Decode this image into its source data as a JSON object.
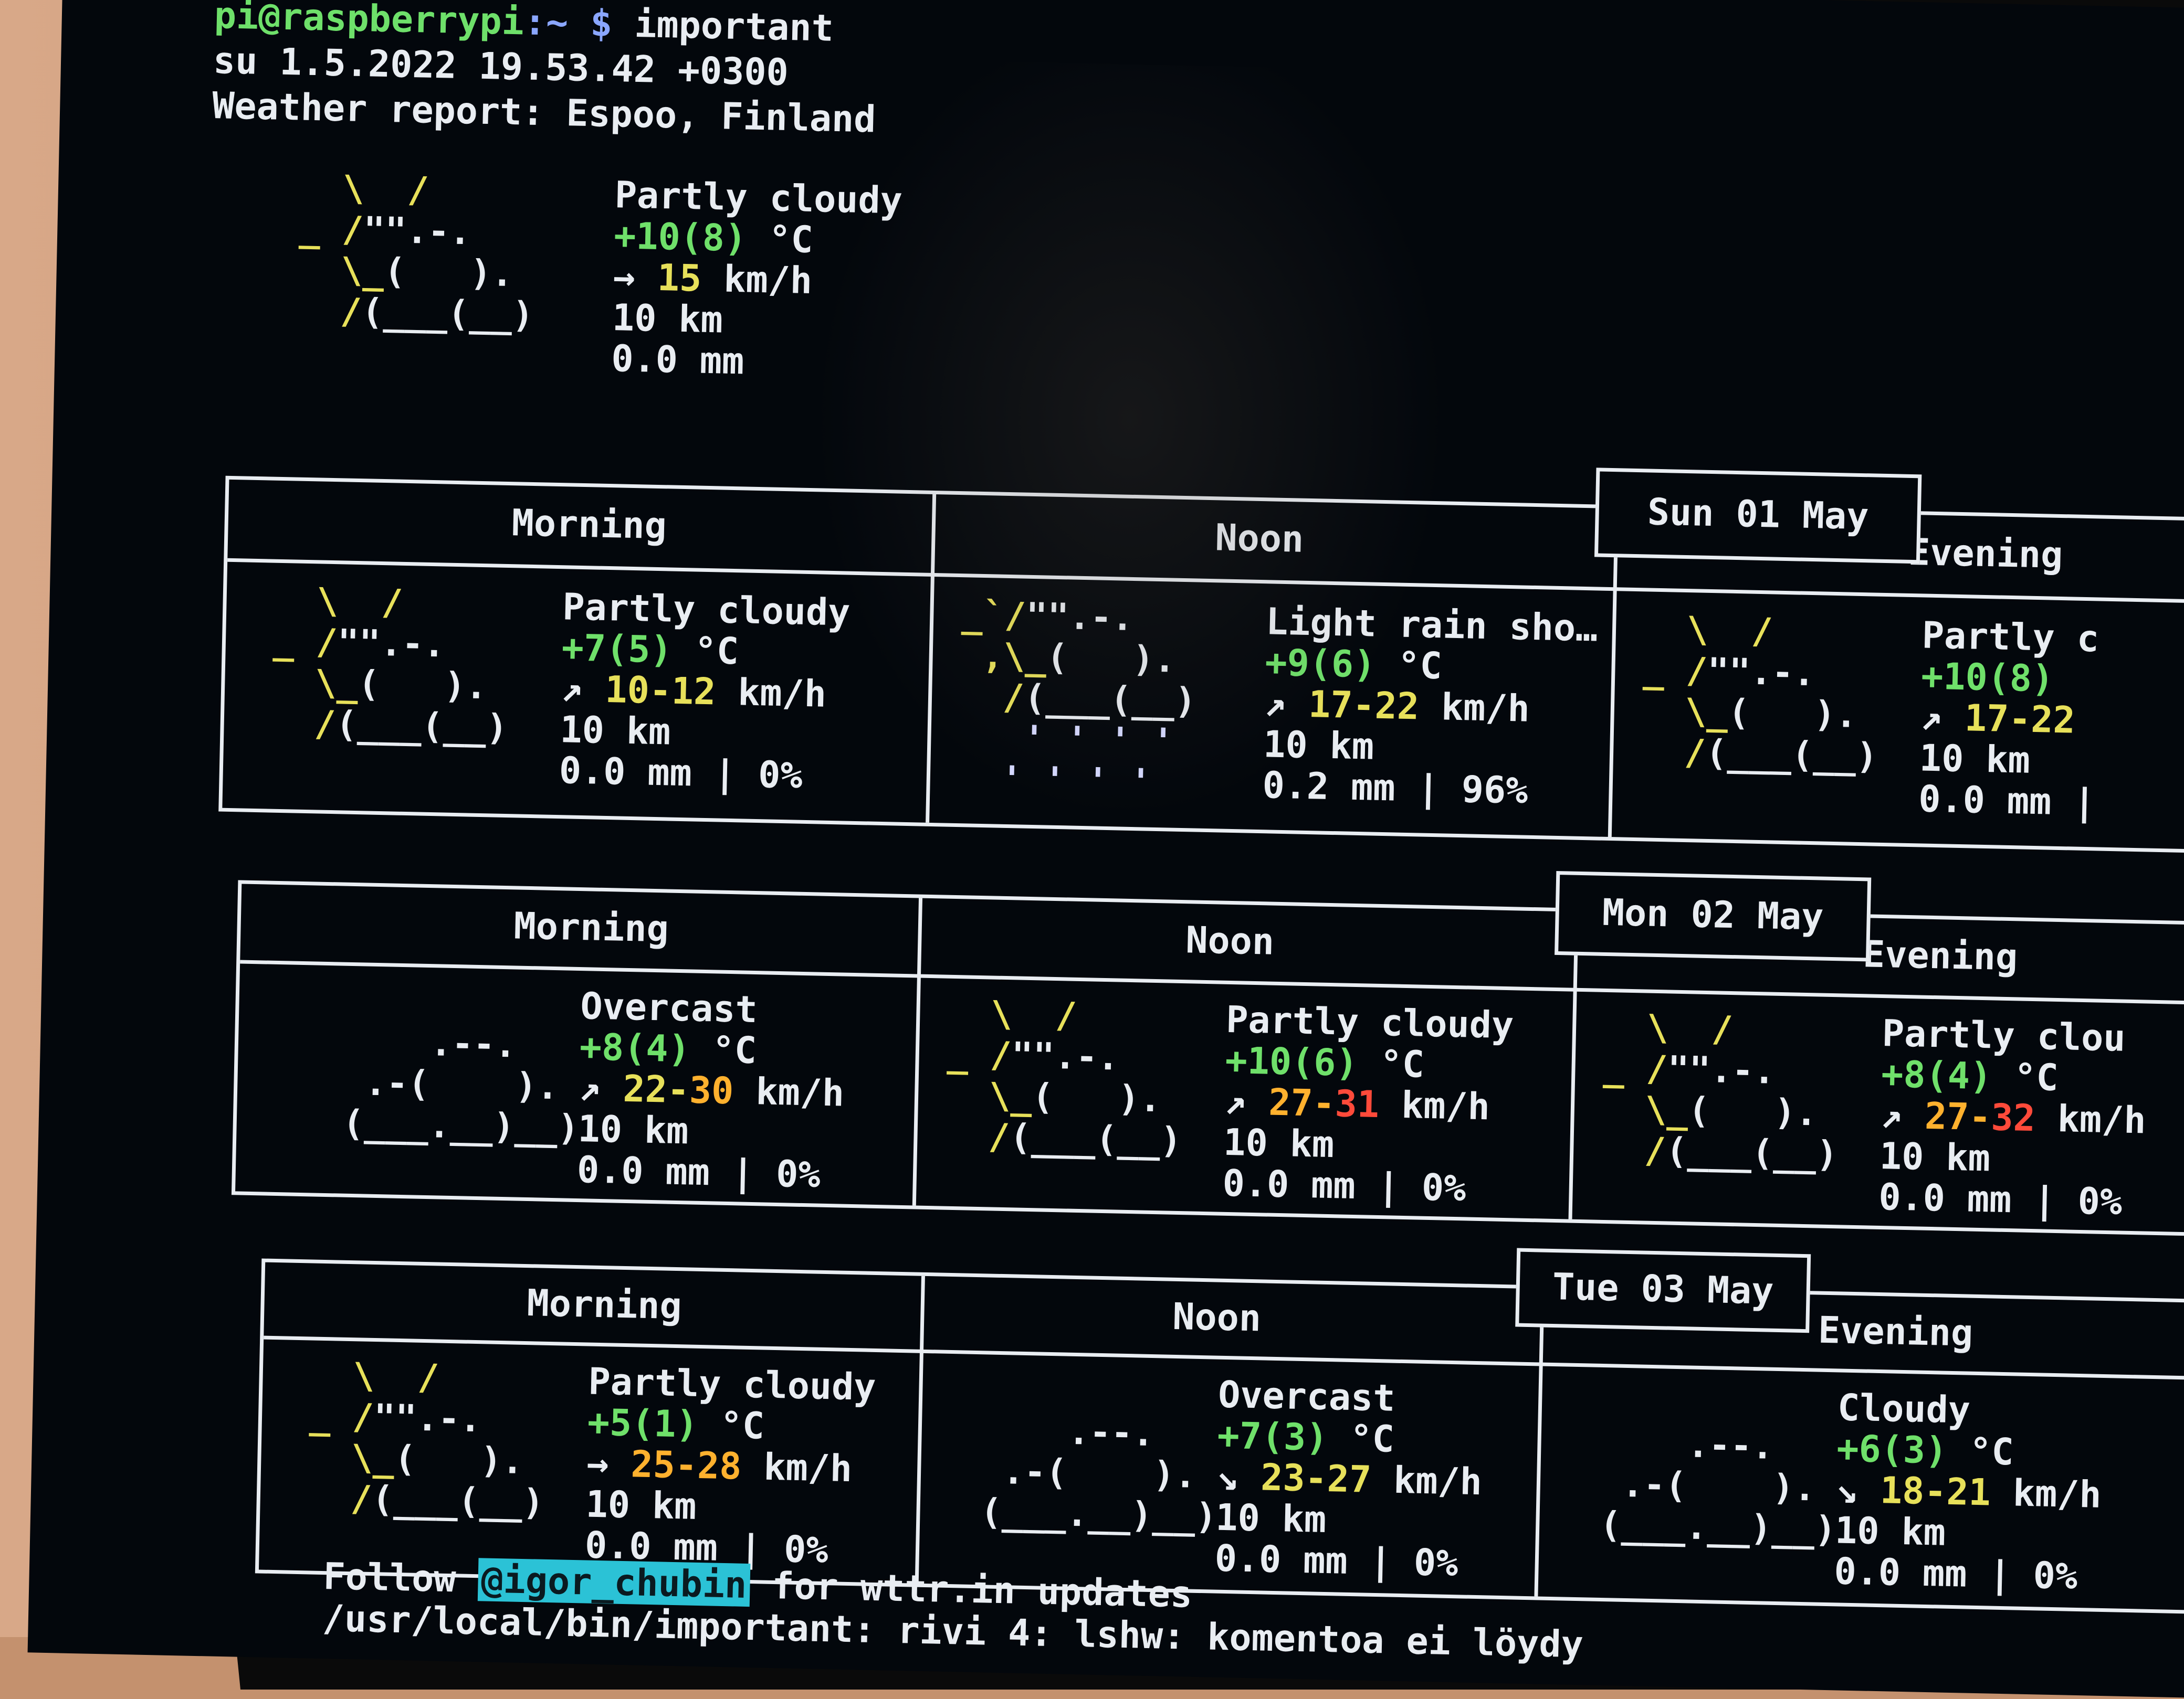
{
  "terminal": {
    "prompt_user": "pi@raspberrypi",
    "prompt_path": ":~ $",
    "command": " important",
    "date_line": "su 1.5.2022 19.53.42 +0300",
    "report_title": "Weather report: Espoo, Finland"
  },
  "current": {
    "condition": "Partly cloudy",
    "temp": "+10(8)",
    "temp_unit": " °C",
    "wind_arrow": "→",
    "wind": "15",
    "wind_unit": " km/h",
    "visibility": "10 km",
    "precip": "0.0 mm"
  },
  "days": [
    {
      "date": "Sun 01 May",
      "periods": [
        {
          "name": "Morning",
          "condition": "Partly cloudy",
          "temp": "+7(5)",
          "wind_arrow": "↗",
          "wind_lo": "10",
          "wind_hi": "12",
          "visibility": "10 km",
          "precip": "0.0 mm | 0%"
        },
        {
          "name": "Noon",
          "condition": "Light rain sho…",
          "temp": "+9(6)",
          "wind_arrow": "↗",
          "wind_lo": "17",
          "wind_hi": "22",
          "visibility": "10 km",
          "precip": "0.2 mm | 96%"
        },
        {
          "name": "Evening",
          "condition": "Partly c",
          "temp": "+10(8)",
          "wind_arrow": "↗",
          "wind_lo": "17",
          "wind_hi": "22",
          "visibility": "10 km",
          "precip": "0.0 mm |"
        }
      ]
    },
    {
      "date": "Mon 02 May",
      "periods": [
        {
          "name": "Morning",
          "condition": "Overcast",
          "temp": "+8(4)",
          "wind_arrow": "↗",
          "wind_lo": "22",
          "wind_hi": "30",
          "visibility": "10 km",
          "precip": "0.0 mm | 0%"
        },
        {
          "name": "Noon",
          "condition": "Partly cloudy",
          "temp": "+10(6)",
          "wind_arrow": "↗",
          "wind_lo": "27",
          "wind_hi": "31",
          "visibility": "10 km",
          "precip": "0.0 mm | 0%"
        },
        {
          "name": "Evening",
          "condition": "Partly clou",
          "temp": "+8(4)",
          "wind_arrow": "↗",
          "wind_lo": "27",
          "wind_hi": "32",
          "visibility": "10 km",
          "precip": "0.0 mm | 0%"
        }
      ]
    },
    {
      "date": "Tue 03 May",
      "periods": [
        {
          "name": "Morning",
          "condition": "Partly cloudy",
          "temp": "+5(1)",
          "wind_arrow": "→",
          "wind_lo": "25",
          "wind_hi": "28",
          "visibility": "10 km",
          "precip": "0.0 mm | 0%"
        },
        {
          "name": "Noon",
          "condition": "Overcast",
          "temp": "+7(3)",
          "wind_arrow": "↘",
          "wind_lo": "23",
          "wind_hi": "27",
          "visibility": "10 km",
          "precip": "0.0 mm | 0%"
        },
        {
          "name": "Evening",
          "condition": "Cloudy",
          "temp": "+6(3)",
          "wind_arrow": "↘",
          "wind_lo": "18",
          "wind_hi": "21",
          "visibility": "10 km",
          "precip": "0.0 mm | 0%"
        }
      ]
    }
  ],
  "units": {
    "temp": " °C",
    "wind": " km/h"
  },
  "footer": {
    "follow_prefix": "Follow ",
    "handle": "@igor_chubin",
    "follow_suffix": " for wttr.in updates",
    "error_line": "/usr/local/bin/important: rivi 4: lshw: komentoa ei löydy"
  },
  "colors": {
    "terminal_bg": "#03070c",
    "prompt_green": "#6ee06a",
    "sun_yellow": "#e7e05a",
    "wind_yellow": "#e7e05a",
    "wind_orange": "#ffb12e",
    "wind_red": "#ff4a3a",
    "handle_bg": "#2bc2d6"
  }
}
